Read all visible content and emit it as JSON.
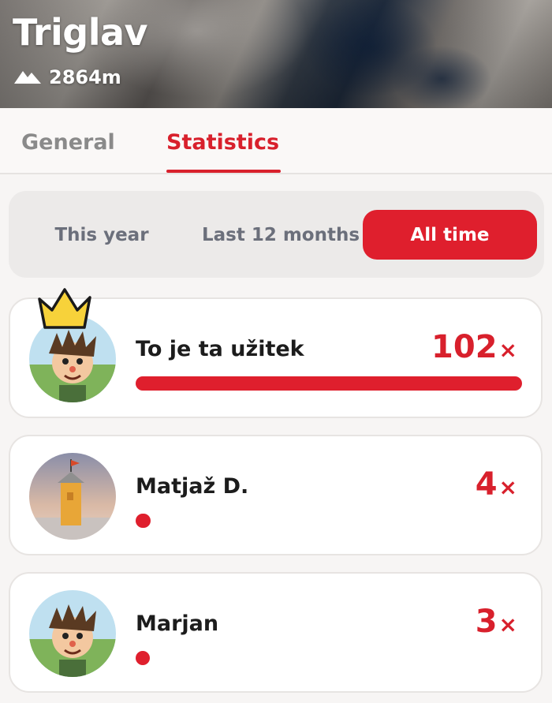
{
  "peak": {
    "name": "Triglav",
    "elevation": "2864m",
    "elevation_icon": "mountain-icon"
  },
  "tabs": [
    {
      "label": "General",
      "active": false
    },
    {
      "label": "Statistics",
      "active": true
    }
  ],
  "period_filter": {
    "options": [
      "This year",
      "Last 12 months",
      "All time"
    ],
    "selected": "All time"
  },
  "leaderboard": [
    {
      "name": "To je ta užitek",
      "count": "102",
      "suffix": "×",
      "bar_fraction": 1.0,
      "leader": true
    },
    {
      "name": "Matjaž D.",
      "count": "4",
      "suffix": "×",
      "bar_fraction": 0.039,
      "leader": false
    },
    {
      "name": "Marjan",
      "count": "3",
      "suffix": "×",
      "bar_fraction": 0.029,
      "leader": false
    }
  ],
  "colors": {
    "accent": "#df1f2d",
    "inactive_tab": "#8a8a8a",
    "segment_text": "#6b6f7b"
  }
}
